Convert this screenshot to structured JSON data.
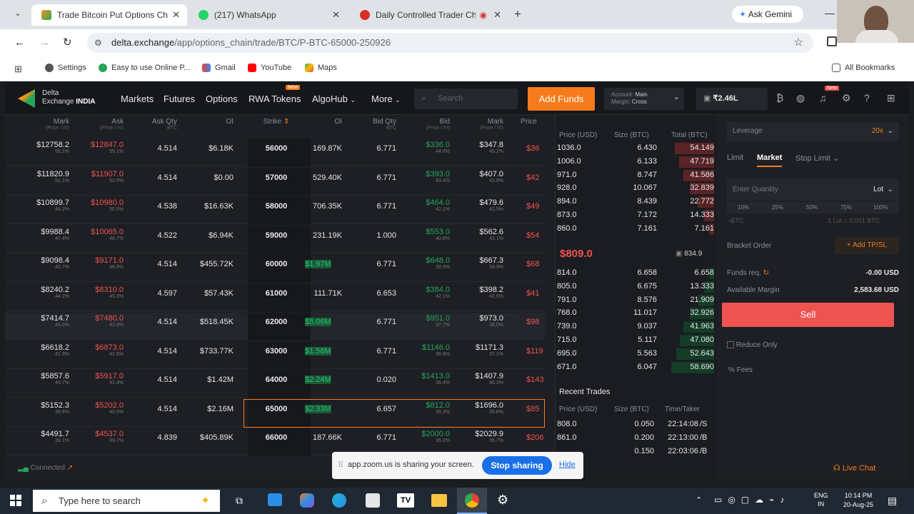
{
  "browser": {
    "tabs": [
      {
        "title": "Trade Bitcoin Put Options Chain",
        "active": true
      },
      {
        "title": "(217) WhatsApp",
        "active": false
      },
      {
        "title": "Daily Controlled Trader Ch...",
        "active": false
      }
    ],
    "ask_gemini": "Ask Gemini",
    "url_host": "delta.exchange",
    "url_path": "/app/options_chain/trade/BTC/P-BTC-65000-250926",
    "bookmarks": [
      "Settings",
      "Easy to use Online P...",
      "Gmail",
      "YouTube",
      "Maps"
    ],
    "all_bookmarks": "All Bookmarks"
  },
  "nav": {
    "logo_line1": "Delta",
    "logo_line2": "Exchange",
    "logo_region": "INDIA",
    "items": [
      "Markets",
      "Futures",
      "Options",
      "RWA Tokens",
      "AlgoHub",
      "More"
    ],
    "rwa_badge": "New",
    "search_placeholder": "Search",
    "add_funds": "Add Funds",
    "account_label": "Account:",
    "account_value": "Main",
    "margin_label": "Margin:",
    "margin_value": "Cross",
    "balance": "₹2.46L",
    "notif_badge": "New"
  },
  "chain": {
    "headers": {
      "left": [
        "Mark",
        "Ask",
        "Ask Qty",
        "OI"
      ],
      "left_sub": [
        "(Price / IV)",
        "(Price / IV)",
        "BTC",
        ""
      ],
      "strike": "Strike",
      "right": [
        "OI",
        "Bid Qty",
        "Bid",
        "Mark",
        "Price"
      ],
      "right_sub": [
        "",
        "BTC",
        "(Price / IV)",
        "(Price / IV)",
        ""
      ]
    },
    "rows": [
      {
        "mark": "$12758.2",
        "mark_iv": "55.1%",
        "ask": "$12847.0",
        "ask_iv": "55.1%",
        "askqty": "4.514",
        "oi_l": "$6.18K",
        "strike": "56000",
        "oi_r": "169.87K",
        "bidqty": "6.771",
        "bid": "$336.0",
        "bid_iv": "44.8%",
        "mark2": "$347.8",
        "mark2_iv": "45.2%",
        "px": "$36"
      },
      {
        "mark": "$11820.9",
        "mark_iv": "51.1%",
        "ask": "$11907.0",
        "ask_iv": "52.9%",
        "askqty": "4.514",
        "oi_l": "$0.00",
        "strike": "57000",
        "oi_r": "529.40K",
        "bidqty": "6.771",
        "bid": "$393.0",
        "bid_iv": "43.4%",
        "mark2": "$407.0",
        "mark2_iv": "43.8%",
        "px": "$42"
      },
      {
        "mark": "$10899.7",
        "mark_iv": "49.2%",
        "ask": "$10980.0",
        "ask_iv": "50.5%",
        "askqty": "4.538",
        "oi_l": "$16.63K",
        "strike": "58000",
        "oi_r": "706.35K",
        "bidqty": "6.771",
        "bid": "$464.0",
        "bid_iv": "42.1%",
        "mark2": "$479.6",
        "mark2_iv": "42.5%",
        "px": "$49"
      },
      {
        "mark": "$9988.4",
        "mark_iv": "47.4%",
        "ask": "$10065.0",
        "ask_iv": "48.7%",
        "askqty": "4.522",
        "oi_l": "$6.94K",
        "strike": "59000",
        "oi_r": "231.19K",
        "bidqty": "1.000",
        "bid": "$553.0",
        "bid_iv": "40.8%",
        "mark2": "$562.6",
        "mark2_iv": "41.1%",
        "px": "$54"
      },
      {
        "mark": "$9098.4",
        "mark_iv": "45.7%",
        "ask": "$9171.0",
        "ask_iv": "46.8%",
        "askqty": "4.514",
        "oi_l": "$455.72K",
        "strike": "60000",
        "oi_r": "$1.97M",
        "bidqty": "6.771",
        "bid": "$648.0",
        "bid_iv": "39.5%",
        "mark2": "$667.3",
        "mark2_iv": "39.9%",
        "px": "$68"
      },
      {
        "mark": "$8240.2",
        "mark_iv": "44.2%",
        "ask": "$8310.0",
        "ask_iv": "45.3%",
        "askqty": "4.597",
        "oi_l": "$57.43K",
        "strike": "61000",
        "oi_r": "111.71K",
        "bidqty": "6.653",
        "bid": "$384.0",
        "bid_iv": "42.1%",
        "mark2": "$398.2",
        "mark2_iv": "42.5%",
        "px": "$41"
      },
      {
        "mark": "$7414.7",
        "mark_iv": "43.0%",
        "ask": "$7480.0",
        "ask_iv": "43.9%",
        "askqty": "4.514",
        "oi_l": "$518.45K",
        "strike": "62000",
        "oi_r": "$5.06M",
        "bidqty": "6.771",
        "bid": "$951.0",
        "bid_iv": "37.7%",
        "mark2": "$973.0",
        "mark2_iv": "38.0%",
        "px": "$98"
      },
      {
        "mark": "$6618.2",
        "mark_iv": "41.9%",
        "ask": "$6873.0",
        "ask_iv": "42.6%",
        "askqty": "4.514",
        "oi_l": "$733.77K",
        "strike": "63000",
        "oi_r": "$1.58M",
        "bidqty": "6.771",
        "bid": "$1146.0",
        "bid_iv": "36.8%",
        "mark2": "$1171.3",
        "mark2_iv": "37.1%",
        "px": "$119"
      },
      {
        "mark": "$5857.6",
        "mark_iv": "40.7%",
        "ask": "$5917.0",
        "ask_iv": "41.4%",
        "askqty": "4.514",
        "oi_l": "$1.42M",
        "strike": "64000",
        "oi_r": "$2.24M",
        "bidqty": "0.020",
        "bid": "$1413.0",
        "bid_iv": "36.4%",
        "mark2": "$1407.9",
        "mark2_iv": "36.3%",
        "px": "$143"
      },
      {
        "mark": "$5152.3",
        "mark_iv": "39.9%",
        "ask": "$5202.0",
        "ask_iv": "40.5%",
        "askqty": "4.514",
        "oi_l": "$2.16M",
        "strike": "65000",
        "oi_r": "$2.33M",
        "bidqty": "6.657",
        "bid": "$812.0",
        "bid_iv": "35.3%",
        "mark2": "$1696.0",
        "mark2_iv": "35.8%",
        "px": "$85"
      },
      {
        "mark": "$4491.7",
        "mark_iv": "39.1%",
        "ask": "$4537.0",
        "ask_iv": "39.7%",
        "askqty": "4.839",
        "oi_l": "$405.89K",
        "strike": "66000",
        "oi_r": "187.66K",
        "bidqty": "6.771",
        "bid": "$2000.0",
        "bid_iv": "35.2%",
        "mark2": "$2029.9",
        "mark2_iv": "35.7%",
        "px": "$206"
      }
    ],
    "connected": "Connected"
  },
  "orderbook": {
    "headers": [
      "Price (USD)",
      "Size (BTC)",
      "Total (BTC)"
    ],
    "asks": [
      {
        "price": "1036.0",
        "size": "6.430",
        "total": "54.149",
        "depth": 0.92
      },
      {
        "price": "1006.0",
        "size": "6.133",
        "total": "47.719",
        "depth": 0.81
      },
      {
        "price": "971.0",
        "size": "8.747",
        "total": "41.586",
        "depth": 0.71
      },
      {
        "price": "928.0",
        "size": "10.067",
        "total": "32.839",
        "depth": 0.56
      },
      {
        "price": "894.0",
        "size": "8.439",
        "total": "22.772",
        "depth": 0.39
      },
      {
        "price": "873.0",
        "size": "7.172",
        "total": "14.333",
        "depth": 0.24
      },
      {
        "price": "860.0",
        "size": "7.161",
        "total": "7.161",
        "depth": 0.12
      }
    ],
    "last_price": "$809.0",
    "mark_price": "834.9",
    "bids": [
      {
        "price": "814.0",
        "size": "6.658",
        "total": "6.658",
        "depth": 0.11
      },
      {
        "price": "805.0",
        "size": "6.675",
        "total": "13.333",
        "depth": 0.23
      },
      {
        "price": "791.0",
        "size": "8.576",
        "total": "21.909",
        "depth": 0.37
      },
      {
        "price": "768.0",
        "size": "11.017",
        "total": "32.926",
        "depth": 0.56
      },
      {
        "price": "739.0",
        "size": "9.037",
        "total": "41.963",
        "depth": 0.71
      },
      {
        "price": "715.0",
        "size": "5.117",
        "total": "47.080",
        "depth": 0.8
      },
      {
        "price": "695.0",
        "size": "5.563",
        "total": "52.643",
        "depth": 0.89
      },
      {
        "price": "671.0",
        "size": "6.047",
        "total": "58.690",
        "depth": 1.0
      }
    ]
  },
  "recent_trades": {
    "title": "Recent Trades",
    "headers": [
      "Price (USD)",
      "Size (BTC)",
      "Time/Taker"
    ],
    "rows": [
      {
        "price": "808.0",
        "size": "0.050",
        "time": "22:14:08",
        "taker": "/S"
      },
      {
        "price": "861.0",
        "size": "0.200",
        "time": "22:13:00",
        "taker": "/B"
      },
      {
        "price": "",
        "size": "0.150",
        "time": "22:03:06",
        "taker": "/B"
      }
    ]
  },
  "order_panel": {
    "leverage_label": "Leverage",
    "leverage_value": "20x",
    "tabs": [
      "Limit",
      "Market",
      "Stop Limit"
    ],
    "qty_placeholder": "Enter Quantity",
    "unit": "Lot",
    "pcts": [
      "10%",
      "25%",
      "50%",
      "75%",
      "100%"
    ],
    "btc_hint": "~BTC",
    "lot_hint": "1 Lot = 0.001 BTC",
    "bracket": "Bracket Order",
    "add_tpsl": "Add TP/SL",
    "funds_req": "Funds req.",
    "funds_val": "-0.00 USD",
    "avail_label": "Available Margin",
    "avail_val": "2,583.68 USD",
    "sell": "Sell",
    "reduce_only": "Reduce Only",
    "fees": "% Fees",
    "live_chat": "Live Chat"
  },
  "zoom": {
    "text": "app.zoom.us is sharing your screen.",
    "stop": "Stop sharing",
    "hide": "Hide"
  },
  "taskbar": {
    "search": "Type here to search",
    "lang1": "ENG",
    "lang2": "IN",
    "time": "10:14 PM",
    "date": "20-Aug-25"
  }
}
